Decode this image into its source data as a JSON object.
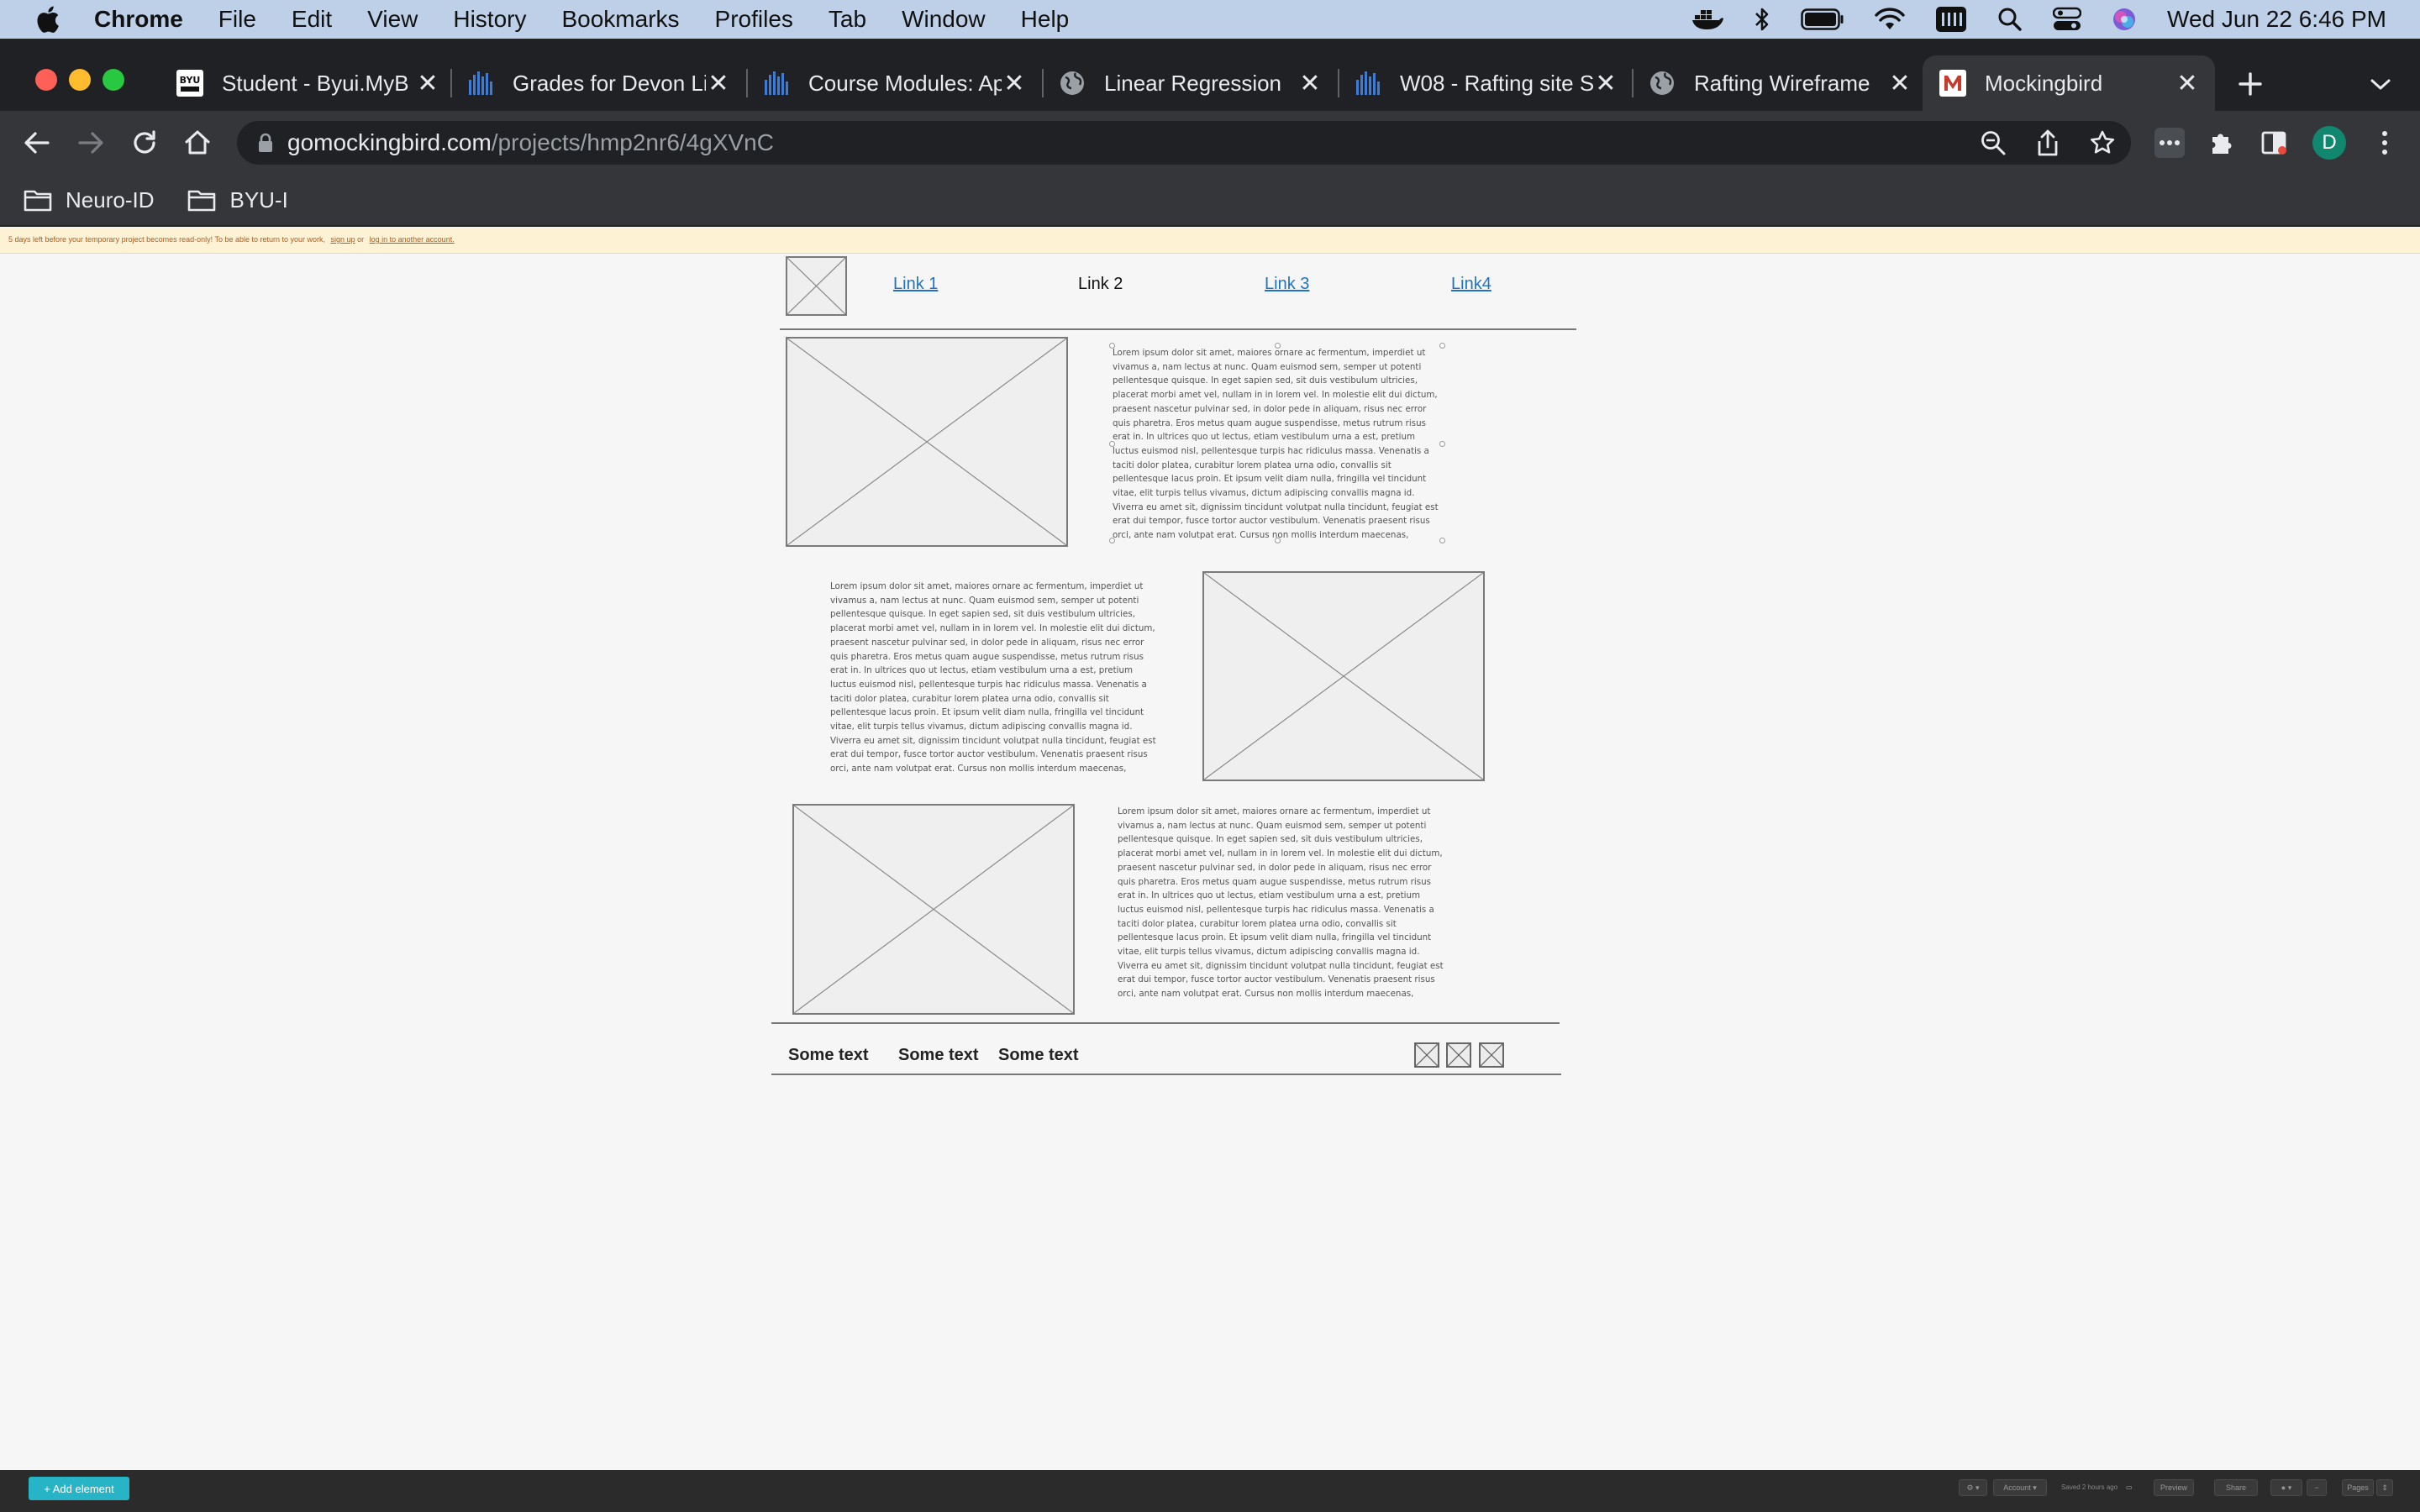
{
  "menubar": {
    "app": "Chrome",
    "items": [
      "File",
      "Edit",
      "View",
      "History",
      "Bookmarks",
      "Profiles",
      "Tab",
      "Window",
      "Help"
    ],
    "clock": "Wed Jun 22  6:46 PM"
  },
  "tabs": [
    {
      "title": "Student - Byui.MyB",
      "icon": "byu-idaho-icon"
    },
    {
      "title": "Grades for Devon Li",
      "icon": "canvas-bars-icon"
    },
    {
      "title": "Course Modules: Ap",
      "icon": "canvas-bars-icon"
    },
    {
      "title": "Linear Regression",
      "icon": "globe-icon"
    },
    {
      "title": "W08 - Rafting site S",
      "icon": "canvas-bars-icon"
    },
    {
      "title": "Rafting Wireframe",
      "icon": "globe-icon"
    },
    {
      "title": "Mockingbird",
      "icon": "mockingbird-icon",
      "active": true
    }
  ],
  "address": {
    "host": "gomockingbird.com",
    "path": "/projects/hmp2nr6/4gXVnC"
  },
  "profile_initial": "D",
  "bookmarks": [
    "Neuro-ID",
    "BYU-I"
  ],
  "banner": {
    "text": "5 days left before your temporary project becomes read-only! To be able to return to your work,",
    "signup": "sign up",
    "or": "or",
    "login": "log in to another account."
  },
  "wireframe": {
    "nav_links": [
      "Link 1",
      "Link 2",
      "Link 3",
      "Link4"
    ],
    "lorem": "Lorem ipsum dolor sit amet, maiores ornare ac fermentum, imperdiet ut vivamus a, nam lectus at nunc. Quam euismod sem, semper ut potenti pellentesque quisque. In eget sapien sed, sit duis vestibulum ultricies, placerat morbi amet vel, nullam in in lorem vel. In molestie elit dui dictum, praesent nascetur pulvinar sed, in dolor pede in aliquam, risus nec error quis pharetra. Eros metus quam augue suspendisse, metus rutrum risus erat in. In ultrices quo ut lectus, etiam vestibulum urna a est, pretium luctus euismod nisl, pellentesque turpis hac ridiculus massa. Venenatis a taciti dolor platea, curabitur lorem platea urna odio, convallis sit pellentesque lacus proin. Et ipsum velit diam nulla, fringilla vel tincidunt vitae, elit turpis tellus vivamus, dictum adipiscing convallis magna id. Viverra eu amet sit, dignissim tincidunt volutpat nulla tincidunt, feugiat est erat dui tempor, fusce tortor auctor vestibulum. Venenatis praesent risus orci, ante nam volutpat erat. Cursus non mollis interdum maecenas, consequat imperdiet penatibus enim, tristique luctus tellus eos accumsan, ridiculus erat laoreet nunc.",
    "footer_texts": [
      "Some text",
      "Some text",
      "Some text"
    ]
  },
  "bottombar": {
    "add_element": "+ Add element",
    "account": "Account ▾",
    "saved": "Saved 2 hours ago",
    "preview": "Preview",
    "share": "Share",
    "pages": "Pages"
  },
  "colors": {
    "menubar": "#bdd0e8",
    "tabstrip": "#202124",
    "toolbar": "#35363a",
    "link": "#1f73c4",
    "add_button": "#27b4c6",
    "banner": "#fdf3d4"
  }
}
